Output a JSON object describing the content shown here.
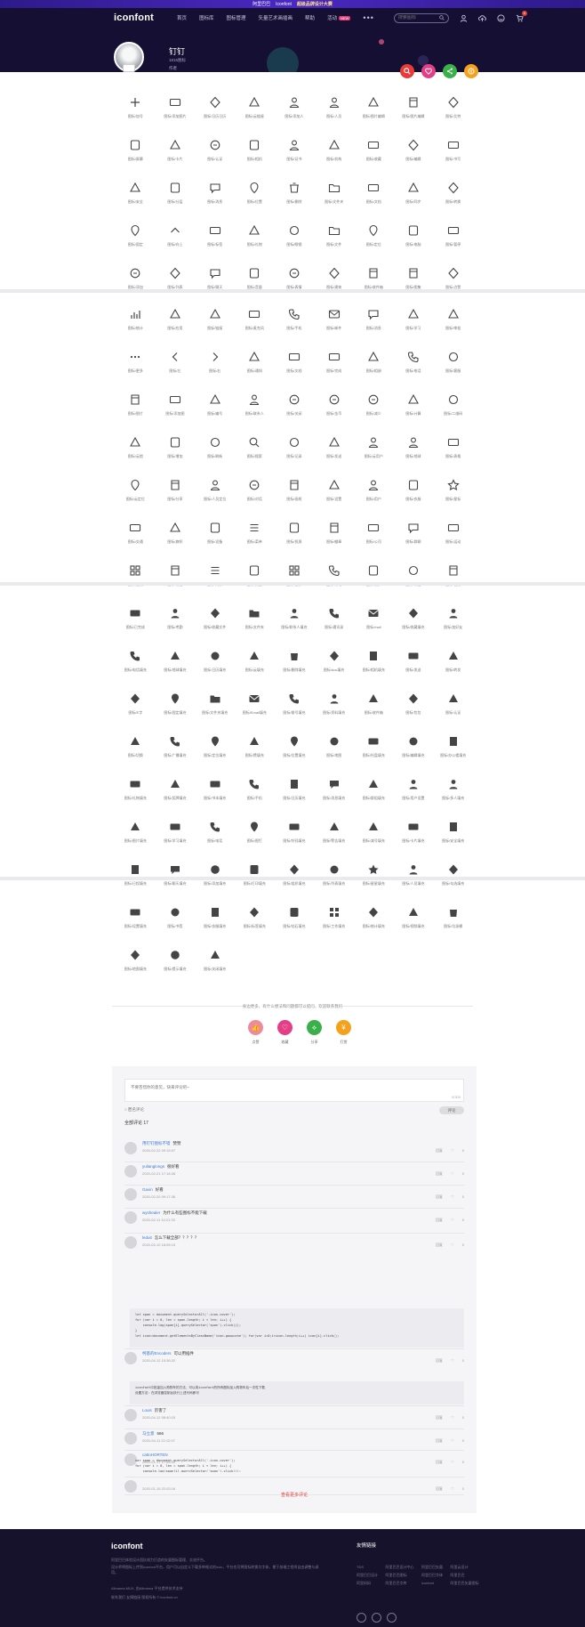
{
  "banner": {
    "prefix": "阿里巴巴",
    "tag": "Iconfont",
    "highlight": "超级品牌设计大赛"
  },
  "nav": {
    "logo": "iconfont",
    "items": [
      "首页",
      "图标库",
      "图标管理",
      "矢量艺术画插画",
      "帮助",
      "活动"
    ],
    "new_badge": "NEW",
    "more": "•••",
    "search_placeholder": "搜索图标"
  },
  "project": {
    "title": "钉钉",
    "meta": [
      "1815图标",
      "作者"
    ]
  },
  "colors": {
    "red": "#e83a3a",
    "pink": "#e43f86",
    "green": "#3bb04a",
    "orange": "#f4a21d",
    "accent": "#4b28c2"
  },
  "icons_section1": [
    {
      "icon": "plus",
      "label": "图标/加号"
    },
    {
      "icon": "add-photo",
      "label": "图标/添加图片"
    },
    {
      "icon": "calendar",
      "label": "图标/日历日历"
    },
    {
      "icon": "cloud-link",
      "label": "图标/云链接"
    },
    {
      "icon": "person-add",
      "label": "图标/添加人"
    },
    {
      "icon": "person-check",
      "label": "图标/人员"
    },
    {
      "icon": "image-edit",
      "label": "图标/图片编辑"
    },
    {
      "icon": "image-edit2",
      "label": "图标/图片编辑"
    },
    {
      "icon": "at",
      "label": "图标/艾特"
    },
    {
      "icon": "screen",
      "label": "图标/屏幕"
    },
    {
      "icon": "card",
      "label": "图标/卡片"
    },
    {
      "icon": "check-circle",
      "label": "图标/认证"
    },
    {
      "icon": "camera",
      "label": "图标/相机"
    },
    {
      "icon": "user-badge",
      "label": "图标/证书"
    },
    {
      "icon": "bank",
      "label": "图标/机构"
    },
    {
      "icon": "box",
      "label": "图标/收藏"
    },
    {
      "icon": "edit-doc",
      "label": "图标/编辑"
    },
    {
      "icon": "note-edit",
      "label": "图标/书写"
    },
    {
      "icon": "lock",
      "label": "图标/安全"
    },
    {
      "icon": "layers",
      "label": "图标/分层"
    },
    {
      "icon": "chat-dots",
      "label": "图标/消息"
    },
    {
      "icon": "location",
      "label": "图标/位置"
    },
    {
      "icon": "trash",
      "label": "图标/删除"
    },
    {
      "icon": "folder",
      "label": "图标/文件夹"
    },
    {
      "icon": "doc",
      "label": "图标/文档"
    },
    {
      "icon": "cloud-sync",
      "label": "图标/同步"
    },
    {
      "icon": "transfer",
      "label": "图标/转换"
    },
    {
      "icon": "pin",
      "label": "图标/固定"
    },
    {
      "icon": "chevron-up",
      "label": "图标/向上"
    },
    {
      "icon": "tag",
      "label": "图标/标签"
    },
    {
      "icon": "gift",
      "label": "图标/礼物"
    },
    {
      "icon": "glasses",
      "label": "图标/眼镜"
    },
    {
      "icon": "folder-open",
      "label": "图标/文件"
    },
    {
      "icon": "location-pin",
      "label": "图标/定位"
    },
    {
      "icon": "laptop",
      "label": "图标/电脑"
    },
    {
      "icon": "pause-doc",
      "label": "图标/暂停"
    },
    {
      "icon": "plus-circle",
      "label": "图标/添加"
    },
    {
      "icon": "list-doc",
      "label": "图标/列表"
    },
    {
      "icon": "chat-square",
      "label": "图标/聊天"
    },
    {
      "icon": "volume",
      "label": "图标/音量"
    },
    {
      "icon": "smile",
      "label": "图标/表情"
    },
    {
      "icon": "building",
      "label": "图标/建筑"
    },
    {
      "icon": "inbox",
      "label": "图标/收件箱"
    },
    {
      "icon": "image-stack",
      "label": "图标/图集"
    },
    {
      "icon": "thumb-up",
      "label": "图标/点赞"
    }
  ],
  "icons_section2": [
    {
      "icon": "bar-chart",
      "label": "图标/统计"
    },
    {
      "icon": "grid",
      "label": "图标/应用"
    },
    {
      "icon": "link",
      "label": "图标/链接"
    },
    {
      "icon": "mic",
      "label": "图标/麦克风"
    },
    {
      "icon": "phone-device",
      "label": "图标/手机"
    },
    {
      "icon": "mail",
      "label": "图标/邮件"
    },
    {
      "icon": "chat-bubble",
      "label": "图标/消息"
    },
    {
      "icon": "graduation",
      "label": "图标/学习"
    },
    {
      "icon": "check-edit",
      "label": "图标/审批"
    },
    {
      "icon": "more",
      "label": "图标/更多"
    },
    {
      "icon": "chevron-left",
      "label": "图标/左"
    },
    {
      "icon": "chevron-right",
      "label": "图标/右"
    },
    {
      "icon": "bell",
      "label": "图标/通知"
    },
    {
      "icon": "doc-lines",
      "label": "图标/文档"
    },
    {
      "icon": "doc-check",
      "label": "图标/完成"
    },
    {
      "icon": "image-card",
      "label": "图标/相册"
    },
    {
      "icon": "phone",
      "label": "图标/电话"
    },
    {
      "icon": "headset",
      "label": "图标/客服"
    },
    {
      "icon": "image",
      "label": "图标/图片"
    },
    {
      "icon": "image-add",
      "label": "图标/添加图"
    },
    {
      "icon": "doc-number",
      "label": "图标/编号"
    },
    {
      "icon": "user-dots",
      "label": "图标/联系人"
    },
    {
      "icon": "close-circle",
      "label": "图标/关闭"
    },
    {
      "icon": "coin",
      "label": "图标/金币"
    },
    {
      "icon": "minus-circle",
      "label": "图标/减少"
    },
    {
      "icon": "calculator",
      "label": "图标/计算"
    },
    {
      "icon": "qr-code",
      "label": "图标/二维码"
    },
    {
      "icon": "cloud-lock",
      "label": "图标/云锁"
    },
    {
      "icon": "plus-outline",
      "label": "图标/增加"
    },
    {
      "icon": "refresh",
      "label": "图标/刷新"
    },
    {
      "icon": "search",
      "label": "图标/搜索"
    },
    {
      "icon": "doc-box",
      "label": "图标/记录"
    },
    {
      "icon": "send",
      "label": "图标/发送"
    },
    {
      "icon": "user-cloud",
      "label": "图标/云用户"
    },
    {
      "icon": "globe-user",
      "label": "图标/地球"
    },
    {
      "icon": "doc-table",
      "label": "图标/表格"
    },
    {
      "icon": "cloud-pin",
      "label": "图标/云定位"
    },
    {
      "icon": "share",
      "label": "图标/分享"
    },
    {
      "icon": "user-location",
      "label": "图标/人员定位"
    },
    {
      "icon": "chat-circle",
      "label": "图标/对话"
    },
    {
      "icon": "image-frame",
      "label": "图标/画框"
    },
    {
      "icon": "gear",
      "label": "图标/设置"
    },
    {
      "icon": "user-outline",
      "label": "图标/用户"
    },
    {
      "icon": "tshirt",
      "label": "图标/衣服"
    },
    {
      "icon": "star",
      "label": "图标/星标"
    },
    {
      "icon": "car",
      "label": "图标/交通"
    },
    {
      "icon": "flag",
      "label": "图标/旗帜"
    },
    {
      "icon": "device",
      "label": "图标/设备"
    },
    {
      "icon": "menu",
      "label": "图标/菜单"
    },
    {
      "icon": "screen-share",
      "label": "图标/投屏"
    },
    {
      "icon": "badge",
      "label": "图标/徽章"
    },
    {
      "icon": "buildings",
      "label": "图标/公司"
    },
    {
      "icon": "chat-double",
      "label": "图标/群聊"
    },
    {
      "icon": "run",
      "label": "图标/运动"
    },
    {
      "icon": "apps",
      "label": "图标/应用"
    },
    {
      "icon": "alert",
      "label": "图标/警告"
    },
    {
      "icon": "list",
      "label": "图标/列表"
    },
    {
      "icon": "shield",
      "label": "图标/安全"
    },
    {
      "icon": "grid-alt",
      "label": "图标/工作"
    },
    {
      "icon": "phone-call",
      "label": "图标/来电"
    },
    {
      "icon": "shield-check",
      "label": "图标/保护"
    },
    {
      "icon": "tag-alt",
      "label": "图标/标签"
    },
    {
      "icon": "video",
      "label": "图标/视频"
    }
  ],
  "icons_section3": [
    {
      "icon": "check-box",
      "label": "图标/已完成"
    },
    {
      "icon": "user-time",
      "label": "图标/考勤"
    },
    {
      "icon": "doc-star",
      "label": "图标/收藏文件"
    },
    {
      "icon": "folder-fill",
      "label": "图标/文件夹"
    },
    {
      "icon": "user-fill",
      "label": "图标/联系人填充"
    },
    {
      "icon": "phonebook",
      "label": "图标/通讯录"
    },
    {
      "icon": "mail-fill",
      "label": "图标/mail"
    },
    {
      "icon": "box-fill",
      "label": "图标/收藏填充"
    },
    {
      "icon": "user-add-fill",
      "label": "图标/加好友"
    },
    {
      "icon": "phone-box",
      "label": "图标/电话填充"
    },
    {
      "icon": "globe-fill",
      "label": "图标/地球填充"
    },
    {
      "icon": "calendar-fill",
      "label": "图标/日历填充"
    },
    {
      "icon": "cloud-fill",
      "label": "图标/云填充"
    },
    {
      "icon": "trash-fill",
      "label": "图标/删除填充"
    },
    {
      "icon": "doc-fill",
      "label": "图标/doc填充"
    },
    {
      "icon": "camera-fill",
      "label": "图标/相机填充"
    },
    {
      "icon": "send-fill",
      "label": "图标/发送"
    },
    {
      "icon": "share-fill",
      "label": "图标/转发"
    },
    {
      "icon": "e-letter",
      "label": "图标/E字"
    },
    {
      "icon": "pin-fill",
      "label": "图标/固定填充"
    },
    {
      "icon": "folder-doc-fill",
      "label": "图标/文件夹填充"
    },
    {
      "icon": "mail-alt-fill",
      "label": "图标/Email填充"
    },
    {
      "icon": "phone-dial-fill",
      "label": "图标/拨号填充"
    },
    {
      "icon": "user-doc-fill",
      "label": "图标/资料填充"
    },
    {
      "icon": "inbox-fill",
      "label": "图标/收件箱"
    },
    {
      "icon": "bag-fill",
      "label": "图标/包包"
    },
    {
      "icon": "badge-check-fill",
      "label": "图标/认证"
    },
    {
      "icon": "swap",
      "label": "图标/切换"
    },
    {
      "icon": "megaphone",
      "label": "图标/广播填充"
    },
    {
      "icon": "pin-drop-fill",
      "label": "图标/定位填充"
    },
    {
      "icon": "thumb-fill",
      "label": "图标/赞填充"
    },
    {
      "icon": "location-fill",
      "label": "图标/位置填充"
    },
    {
      "icon": "map-edit-fill",
      "label": "图标/地图"
    },
    {
      "icon": "tray-fill",
      "label": "图标/托盘填充"
    },
    {
      "icon": "doc-edit-fill",
      "label": "图标/编辑填充"
    },
    {
      "icon": "office-fill",
      "label": "图标/办公楼填充"
    },
    {
      "icon": "gift-fill",
      "label": "图标/礼物填充"
    },
    {
      "icon": "medal-fill",
      "label": "图标/奖牌填充"
    },
    {
      "icon": "book-fill",
      "label": "图标/书本填充"
    },
    {
      "icon": "phone-fill",
      "label": "图标/手机"
    },
    {
      "icon": "calendar-alt-fill",
      "label": "图标/日历填充"
    },
    {
      "icon": "chat-fill",
      "label": "图标/消息填充"
    },
    {
      "icon": "group-fill",
      "label": "图标/群组填充"
    },
    {
      "icon": "user-settings-fill",
      "label": "图标/用户设置"
    },
    {
      "icon": "users-fill",
      "label": "图标/多人填充"
    },
    {
      "icon": "image-fill",
      "label": "图标/图片填充"
    },
    {
      "icon": "grad-fill",
      "label": "图标/学习填充"
    },
    {
      "icon": "call-fill",
      "label": "图标/电话"
    },
    {
      "icon": "pin-tilt-fill",
      "label": "图标/图钉"
    },
    {
      "icon": "bell-fill",
      "label": "图标/铃铛填充"
    },
    {
      "icon": "alert-fill",
      "label": "图标/警告填充"
    },
    {
      "icon": "minus-fill",
      "label": "图标/减号填充"
    },
    {
      "icon": "card-fill",
      "label": "图标/卡片填充"
    },
    {
      "icon": "shield-fill",
      "label": "图标/安全填充"
    },
    {
      "icon": "calendar-box-fill",
      "label": "图标/日程填充"
    },
    {
      "icon": "chat-dots-fill",
      "label": "图标/聊天填充"
    },
    {
      "icon": "plus-circle-fill",
      "label": "图标/添加填充"
    },
    {
      "icon": "printer-fill",
      "label": "图标/打印填充"
    },
    {
      "icon": "org-fill",
      "label": "图标/组织填充"
    },
    {
      "icon": "doc-list-fill",
      "label": "图标/列表填充"
    },
    {
      "icon": "star-fill",
      "label": "图标/星星填充"
    },
    {
      "icon": "person-fill",
      "label": "图标/人员填充"
    },
    {
      "icon": "check-box-fill",
      "label": "图标/勾选填充"
    },
    {
      "icon": "gear-fill",
      "label": "图标/设置填充"
    },
    {
      "icon": "bookmark-fill",
      "label": "图标/书签"
    },
    {
      "icon": "tshirt-fill",
      "label": "图标/衣服填充"
    },
    {
      "icon": "tag-fill",
      "label": "图标/标签填充"
    },
    {
      "icon": "diamond-fill",
      "label": "图标/钻石填充"
    },
    {
      "icon": "apps-fill",
      "label": "图标/工作填充"
    },
    {
      "icon": "pie-fill",
      "label": "图标/统计填充"
    },
    {
      "icon": "video-fill",
      "label": "图标/视频填充"
    },
    {
      "icon": "trash-alt-fill",
      "label": "图标/垃圾桶"
    },
    {
      "icon": "map-fill",
      "label": "图标/地图填充"
    },
    {
      "icon": "alert-circle-fill",
      "label": "图标/提示填充"
    },
    {
      "icon": "close-fill",
      "label": "图标/关闭填充"
    }
  ],
  "footer_note": "身边更多，有什么想法和问题都可以提问，欢迎联系我们",
  "big_actions": [
    {
      "key": "like",
      "label": "点赞",
      "color": "#ef8a9c"
    },
    {
      "key": "collect",
      "label": "收藏",
      "color": "#e43f86"
    },
    {
      "key": "share",
      "label": "分享",
      "color": "#3bb04a"
    },
    {
      "key": "reward",
      "label": "打赏",
      "color": "#f4a21d"
    }
  ],
  "comments": {
    "input_placeholder": "不要吝惜你的意见，快来评论吧~",
    "counter": "0/300",
    "anon_label": "匿名评论",
    "submit": "评论",
    "count_label": "全部评论",
    "count": "17",
    "rows": [
      {
        "name": "用钉钉图标不错",
        "text": "赞赞",
        "time": "2020-02-22 09:15:07"
      },
      {
        "name": "yulianglongs",
        "text": "很好看",
        "time": "2020-02-21 17:18:28"
      },
      {
        "name": "Gavin",
        "text": "好看",
        "time": "2020-02-20 09:17:36"
      },
      {
        "name": "wyshealer",
        "text": "为什么有些图标不能下载",
        "time": "2020-02-11 10:21:33"
      },
      {
        "name": "leduit",
        "text": "怎么下载全部？？？？？",
        "time": "2020-02-10 18:05:13"
      },
      {
        "name": "柯基的Encoders",
        "text": "可以用插件",
        "time": "2020-04-12 15:38:32"
      },
      {
        "name": "Louis",
        "text": "厉害了",
        "time": "2020-04-12 08:40:15"
      },
      {
        "name": "马立意",
        "text": "666",
        "time": "2020-04-11 22:12:07"
      },
      {
        "name": "cattoHORTEN",
        "text": "",
        "time": "2020-01-17 17:58:02"
      },
      {
        "name": "",
        "text": "",
        "time": "2020-01-15 22:03:16"
      }
    ],
    "reply_label": "回复",
    "like_label": "0",
    "code_block_1": "let span = document.querySelectorAll('.icon-cover');\nfor (var i = 0, len = span.length; i < len; i++) {\n    console.log(span[i].querySelector('span').click());\n}\nlet icon=document.getElementsByClassName('icon-gouwuche'); for(var i=0;i<icon.length;i++) icon[i].click();",
    "code_block_2": "iconfont中批量加入购物车的方法，可以将iconfont的所有图标加入购物车后一次性下载\n设置方法：在浏览器控制台执行上述代码即可",
    "code_block_3": "var span = document.querySelectorAll('.icon-cover');\nfor (var i = 0, len = span.length; i < len; i++) {\n    console.log(span[i].querySelector('span').click());\n}",
    "more": "查看更多评论"
  },
  "site_footer": {
    "logo": "iconfont",
    "desc": [
      "阿里巴巴体验设计团队倾力打造的矢量图标管理、交流平台。",
      "设计师将图标上传到iconfont平台，用户可以自定义下载多种格式的icon，平台也可将图标转换为字体，便于前端工程师自由调整与调用。",
      "Alimama MUX, 由Alimama 平台提供技术支持",
      "联系我们 友情链接 版权所有 © iconfont.cn"
    ],
    "links_title": "友情链接",
    "links": [
      "TDS",
      "阿里巴巴设计中心",
      "阿里巴巴矢量",
      "阿里云设计",
      "阿里巴巴设计",
      "阿里巴巴图标",
      "阿里巴巴字体",
      "阿里巴巴",
      "阿里妈妈",
      "阿里巴巴字库",
      "iconfont",
      "阿里巴巴矢量图标"
    ]
  }
}
